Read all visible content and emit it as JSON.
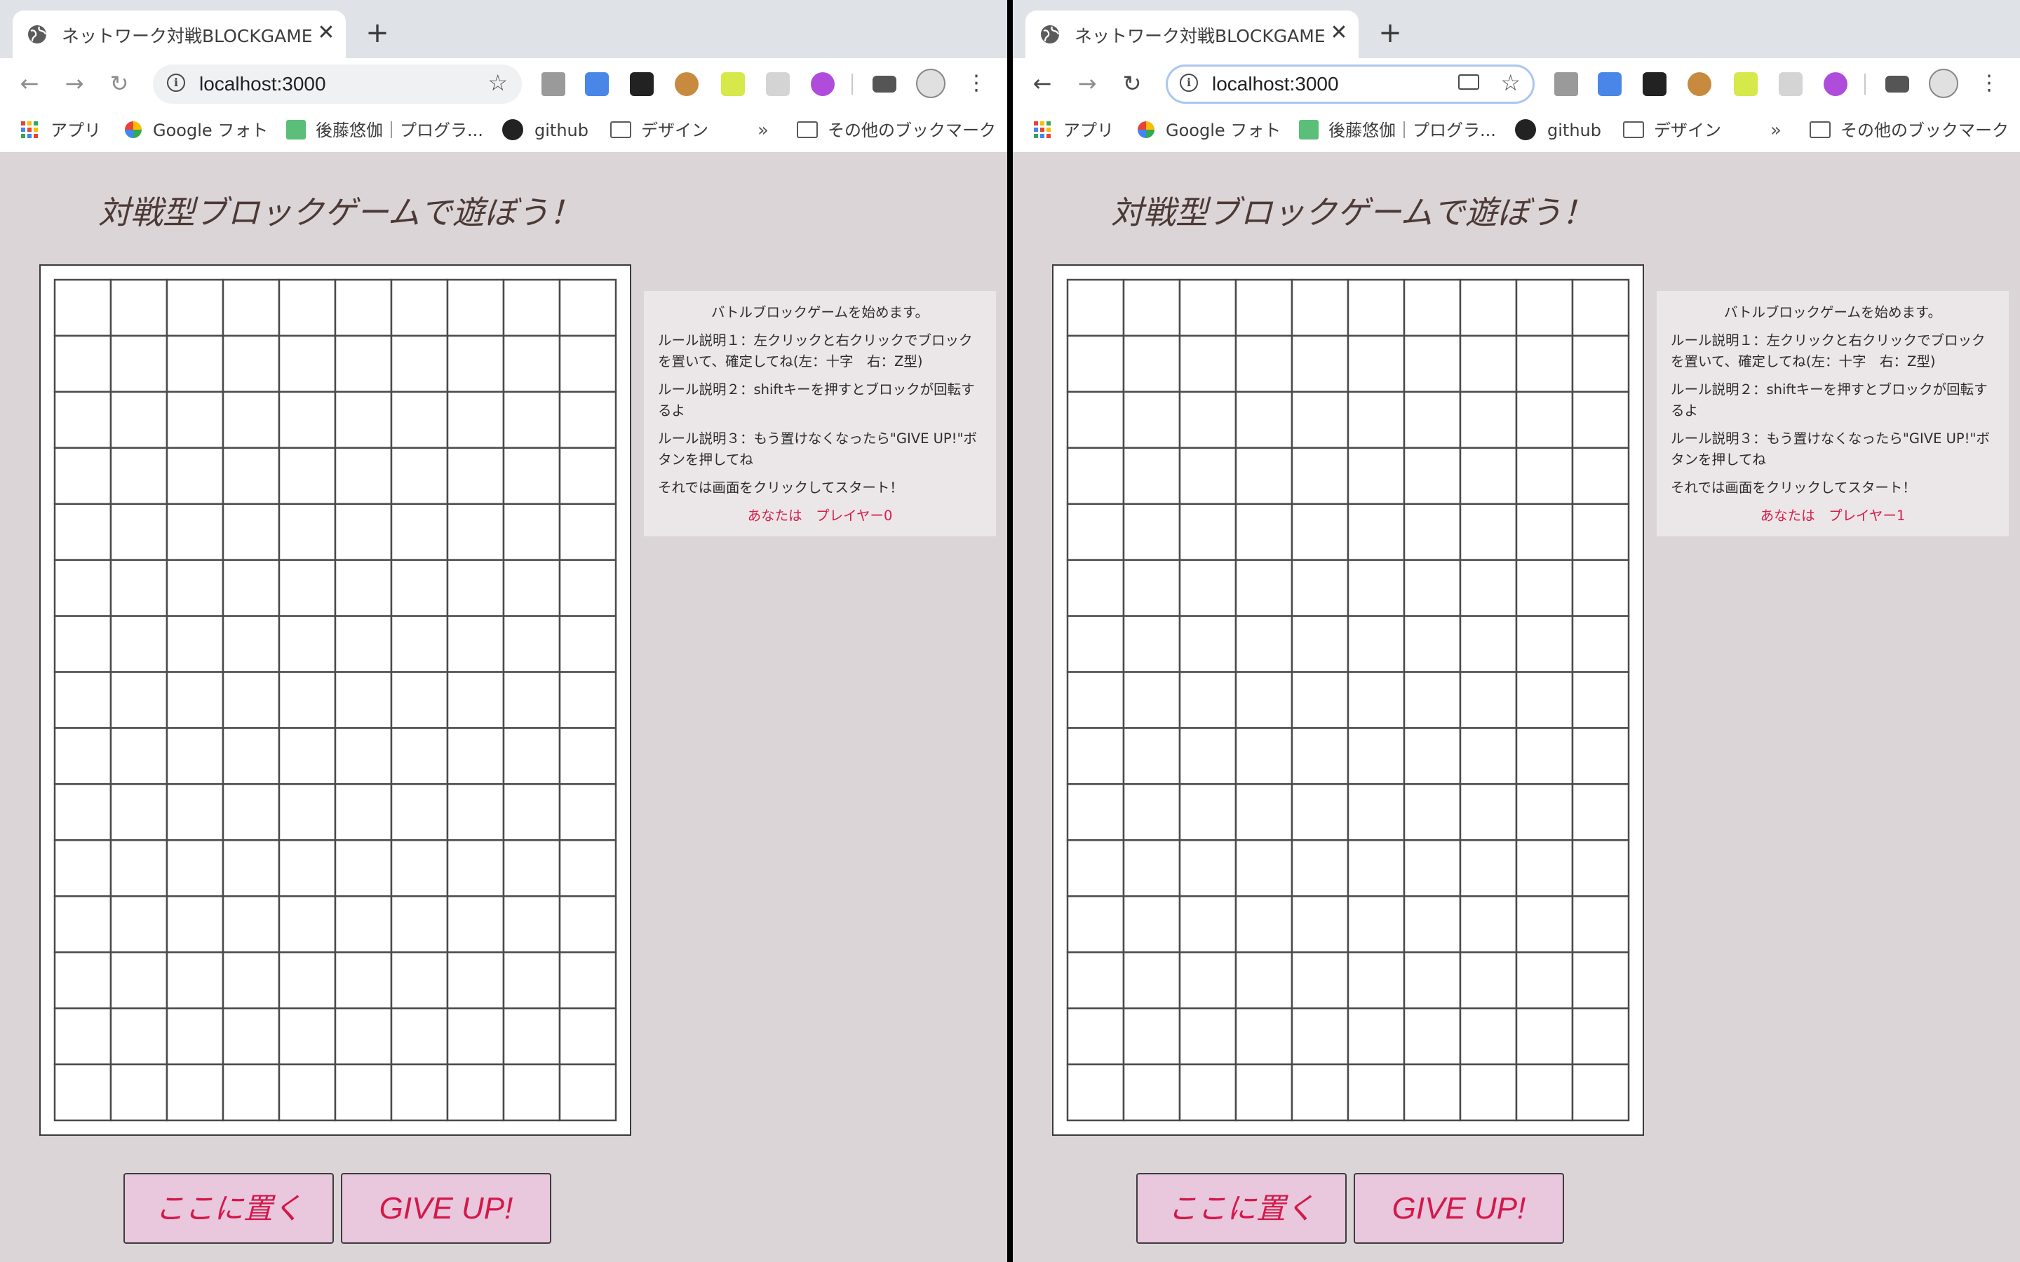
{
  "windows": [
    {
      "tab_title": "ネットワーク対戦BLOCKGAME",
      "url": "localhost:3000",
      "omnibox_focused": false,
      "bookmarks": [
        {
          "label": "アプリ",
          "icon": "apps-icon"
        },
        {
          "label": "Google フォト",
          "icon": "google-photos-icon"
        },
        {
          "label": "後藤悠伽｜プログラ...",
          "icon": "avatar-icon"
        },
        {
          "label": "github",
          "icon": "github-icon"
        },
        {
          "label": "デザイン",
          "icon": "folder-icon"
        }
      ],
      "bookmarks_more": "»",
      "other_bookmarks": "その他のブックマーク",
      "page": {
        "title": "対戦型ブロックゲームで遊ぼう！",
        "info_intro": "バトルブロックゲームを始めます。",
        "rules": [
          "ルール説明１：左クリックと右クリックでブロックを置いて、確定してね(左：十字　右：Z型)",
          "ルール説明２：shiftキーを押すとブロックが回転するよ",
          "ルール説明３：もう置けなくなったら\"GIVE UP!\"ボタンを押してね"
        ],
        "start_text": "それでは画面をクリックしてスタート！",
        "player_text": "あなたは　プレイヤー0",
        "place_button": "ここに置く",
        "giveup_button": "GIVE UP!"
      }
    },
    {
      "tab_title": "ネットワーク対戦BLOCKGAME",
      "url": "localhost:3000",
      "omnibox_focused": true,
      "bookmarks": [
        {
          "label": "アプリ",
          "icon": "apps-icon"
        },
        {
          "label": "Google フォト",
          "icon": "google-photos-icon"
        },
        {
          "label": "後藤悠伽｜プログラ...",
          "icon": "avatar-icon"
        },
        {
          "label": "github",
          "icon": "github-icon"
        },
        {
          "label": "デザイン",
          "icon": "folder-icon"
        }
      ],
      "bookmarks_more": "»",
      "other_bookmarks": "その他のブックマーク",
      "page": {
        "title": "対戦型ブロックゲームで遊ぼう！",
        "info_intro": "バトルブロックゲームを始めます。",
        "rules": [
          "ルール説明１：左クリックと右クリックでブロックを置いて、確定してね(左：十字　右：Z型)",
          "ルール説明２：shiftキーを押すとブロックが回転するよ",
          "ルール説明３：もう置けなくなったら\"GIVE UP!\"ボタンを押してね"
        ],
        "start_text": "それでは画面をクリックしてスタート！",
        "player_text": "あなたは　プレイヤー1",
        "place_button": "ここに置く",
        "giveup_button": "GIVE UP!"
      }
    }
  ],
  "board": {
    "columns": 10,
    "rows": 15
  },
  "colors": {
    "page_bg": "#dcd5d7",
    "button_bg": "#e9c7dd",
    "button_text": "#d3194a",
    "player_text": "#d61f4b",
    "title_text": "#4c3a36"
  }
}
